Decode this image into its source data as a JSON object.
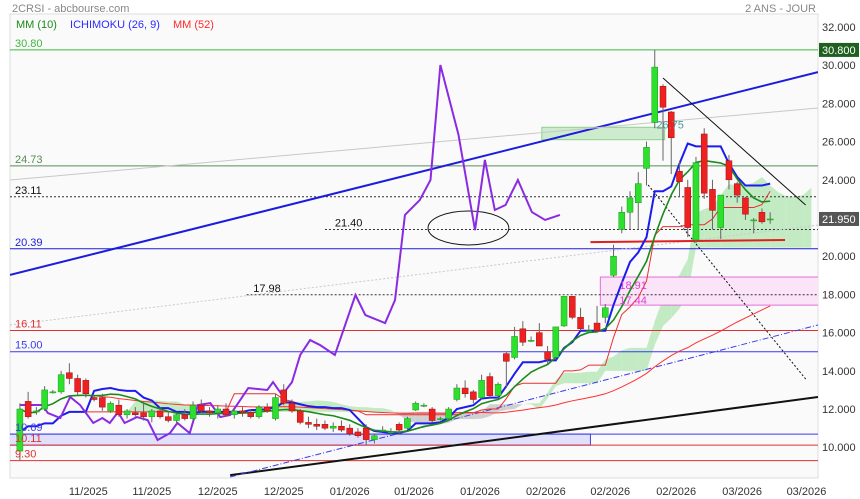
{
  "header": {
    "title": "2CRSI - abcbourse.com",
    "period": "2 ANS - JOUR"
  },
  "legend": [
    {
      "label": "MM (10)",
      "color": "#1a8a1a"
    },
    {
      "label": "ICHIMOKU (26, 9)",
      "color": "#2b2bff"
    },
    {
      "label": "MM (52)",
      "color": "#ff2a2a"
    }
  ],
  "chart_data": {
    "type": "candlestick",
    "title": "2CRSI",
    "ylim": [
      8.39,
      32.68
    ],
    "xlim": [
      -1.2,
      96.8
    ],
    "y_ticks": [
      "32.000",
      "30.000",
      "28.000",
      "26.000",
      "24.000",
      "22.000",
      "20.000",
      "18.000",
      "16.000",
      "14.000",
      "12.000",
      "10.000"
    ],
    "x_ticks": [
      {
        "i": 8.3,
        "label": "11/2025"
      },
      {
        "i": 16.0,
        "label": "11/2025"
      },
      {
        "i": 24.0,
        "label": "12/2025"
      },
      {
        "i": 32.0,
        "label": "12/2025"
      },
      {
        "i": 40.0,
        "label": "01/2026"
      },
      {
        "i": 47.8,
        "label": "01/2026"
      },
      {
        "i": 55.8,
        "label": "01/2026"
      },
      {
        "i": 63.8,
        "label": "02/2026"
      },
      {
        "i": 71.6,
        "label": "02/2026"
      },
      {
        "i": 79.6,
        "label": "02/2026"
      },
      {
        "i": 87.6,
        "label": "03/2026"
      },
      {
        "i": 95.4,
        "label": "03/2026"
      }
    ],
    "price_badges": [
      {
        "value": 30.8,
        "label": "30.800",
        "color": "#1f5f1f"
      },
      {
        "value": 21.95,
        "label": "21.950",
        "color": "#555555"
      }
    ],
    "candles_ohlc": [
      [
        9.8,
        12.3,
        9.3,
        12.0
      ],
      [
        12.4,
        12.9,
        11.5,
        11.6
      ],
      [
        11.9,
        12.1,
        11.7,
        11.9
      ],
      [
        12.0,
        13.2,
        11.9,
        13.0
      ],
      [
        12.9,
        13.0,
        12.8,
        12.9
      ],
      [
        12.9,
        14.0,
        12.8,
        13.8
      ],
      [
        13.9,
        14.4,
        13.3,
        13.6
      ],
      [
        13.6,
        13.8,
        12.7,
        12.9
      ],
      [
        13.5,
        13.6,
        12.6,
        12.8
      ],
      [
        12.6,
        12.7,
        12.4,
        12.5
      ],
      [
        12.6,
        12.8,
        11.9,
        12.1
      ],
      [
        11.9,
        12.4,
        11.8,
        12.3
      ],
      [
        12.2,
        12.5,
        11.6,
        11.7
      ],
      [
        11.7,
        12.0,
        11.5,
        11.9
      ],
      [
        11.8,
        12.1,
        11.6,
        11.7
      ],
      [
        11.8,
        12.3,
        11.4,
        11.6
      ],
      [
        11.6,
        12.0,
        11.3,
        11.9
      ],
      [
        11.9,
        12.1,
        11.5,
        11.6
      ],
      [
        11.6,
        11.9,
        11.3,
        11.4
      ],
      [
        11.4,
        11.8,
        11.2,
        11.7
      ],
      [
        11.7,
        12.0,
        11.4,
        11.5
      ],
      [
        11.5,
        12.4,
        11.4,
        12.2
      ],
      [
        12.2,
        12.5,
        11.8,
        11.9
      ],
      [
        11.9,
        12.1,
        11.6,
        11.8
      ],
      [
        11.8,
        12.2,
        11.5,
        12.0
      ],
      [
        12.0,
        12.3,
        11.6,
        11.7
      ],
      [
        11.7,
        12.0,
        11.5,
        11.9
      ],
      [
        11.9,
        12.1,
        11.6,
        11.8
      ],
      [
        11.8,
        12.0,
        11.5,
        11.6
      ],
      [
        11.6,
        12.2,
        11.5,
        12.1
      ],
      [
        12.1,
        12.3,
        11.8,
        11.9
      ],
      [
        11.5,
        12.8,
        11.4,
        12.6
      ],
      [
        13.0,
        13.3,
        12.2,
        12.3
      ],
      [
        12.3,
        12.5,
        11.8,
        11.9
      ],
      [
        11.9,
        12.0,
        11.2,
        11.3
      ],
      [
        11.3,
        11.6,
        11.0,
        11.2
      ],
      [
        11.2,
        11.5,
        10.9,
        11.1
      ],
      [
        11.2,
        11.4,
        10.9,
        11.0
      ],
      [
        11.0,
        11.3,
        10.8,
        11.1
      ],
      [
        11.1,
        11.4,
        10.8,
        10.9
      ],
      [
        11.0,
        11.2,
        10.6,
        10.7
      ],
      [
        10.8,
        11.0,
        10.5,
        10.6
      ],
      [
        11.0,
        11.2,
        10.1,
        10.4
      ],
      [
        10.4,
        10.7,
        10.2,
        10.6
      ],
      [
        10.9,
        11.1,
        10.8,
        10.9
      ],
      [
        10.8,
        11.0,
        10.7,
        10.8
      ],
      [
        11.2,
        11.3,
        10.7,
        10.9
      ],
      [
        11.0,
        11.6,
        10.9,
        11.5
      ],
      [
        11.95,
        12.4,
        11.9,
        12.3
      ],
      [
        12.2,
        12.3,
        12.1,
        12.2
      ],
      [
        12.0,
        12.1,
        11.3,
        11.4
      ],
      [
        11.5,
        11.6,
        11.4,
        11.5
      ],
      [
        11.5,
        12.1,
        11.4,
        12.0
      ],
      [
        12.5,
        13.3,
        12.4,
        13.1
      ],
      [
        13.1,
        13.5,
        12.6,
        12.8
      ],
      [
        12.9,
        13.0,
        12.3,
        12.5
      ],
      [
        12.6,
        13.8,
        12.5,
        13.5
      ],
      [
        13.7,
        13.9,
        12.6,
        12.7
      ],
      [
        12.7,
        13.4,
        12.5,
        13.3
      ],
      [
        14.9,
        15.0,
        13.1,
        14.5
      ],
      [
        14.7,
        16.3,
        14.6,
        15.8
      ],
      [
        16.2,
        16.6,
        15.3,
        15.5
      ],
      [
        15.6,
        15.8,
        15.5,
        15.6
      ],
      [
        16.0,
        16.5,
        15.3,
        15.3
      ],
      [
        15.0,
        15.3,
        14.3,
        14.6
      ],
      [
        14.7,
        16.3,
        14.6,
        16.3
      ],
      [
        16.35,
        17.9,
        16.3,
        17.9
      ],
      [
        17.9,
        17.9,
        16.7,
        16.8
      ],
      [
        16.8,
        17.3,
        16.1,
        16.2
      ],
      [
        16.1,
        16.4,
        16.0,
        16.1
      ],
      [
        16.5,
        17.4,
        16.0,
        16.1
      ],
      [
        16.8,
        17.5,
        16.5,
        17.3
      ],
      [
        19.0,
        20.6,
        18.9,
        20.0
      ],
      [
        21.4,
        22.6,
        21.2,
        22.3
      ],
      [
        22.3,
        23.4,
        21.4,
        23.05
      ],
      [
        22.8,
        24.4,
        21.4,
        23.8
      ],
      [
        24.6,
        26.0,
        23.7,
        25.7
      ],
      [
        27.0,
        30.8,
        26.7,
        29.9
      ],
      [
        28.9,
        29.0,
        25.0,
        27.8
      ],
      [
        27.55,
        27.6,
        24.3,
        26.2
      ],
      [
        24.45,
        25.0,
        23.1,
        23.9
      ],
      [
        23.6,
        24.0,
        21.0,
        21.5
      ],
      [
        20.85,
        25.2,
        20.7,
        24.9
      ],
      [
        26.4,
        26.7,
        23.0,
        23.3
      ],
      [
        23.5,
        24.0,
        21.4,
        22.4
      ],
      [
        21.5,
        23.2,
        20.9,
        23.2
      ],
      [
        25.0,
        25.3,
        23.5,
        24.0
      ],
      [
        23.8,
        23.9,
        22.8,
        23.2
      ],
      [
        23.05,
        23.1,
        21.9,
        22.2
      ],
      [
        21.9,
        22.0,
        21.2,
        21.9
      ],
      [
        22.3,
        22.5,
        21.7,
        21.8
      ],
      [
        21.95,
        22.3,
        21.7,
        21.95
      ]
    ],
    "comparison_series": {
      "color": "#8a2be2",
      "points": [
        [
          0,
          12.21
        ],
        [
          2.7,
          12.21
        ],
        [
          3.4,
          11.79
        ],
        [
          4.9,
          11.53
        ],
        [
          6.1,
          12.63
        ],
        [
          7.3,
          12.21
        ],
        [
          8.9,
          11.27
        ],
        [
          10.0,
          11.53
        ],
        [
          10.9,
          11.27
        ],
        [
          11.9,
          11.84
        ],
        [
          12.7,
          11.27
        ],
        [
          14.2,
          11.58
        ],
        [
          15.5,
          11.42
        ],
        [
          16.7,
          10.38
        ],
        [
          18.2,
          10.74
        ],
        [
          19.1,
          11.27
        ],
        [
          20.6,
          10.74
        ],
        [
          21.6,
          12.21
        ],
        [
          23.1,
          12.31
        ],
        [
          24.3,
          11.58
        ],
        [
          25.5,
          11.69
        ],
        [
          27.7,
          13.1
        ],
        [
          30.0,
          13.0
        ],
        [
          30.7,
          13.41
        ],
        [
          31.8,
          12.73
        ],
        [
          33.0,
          13.41
        ],
        [
          34.0,
          14.83
        ],
        [
          35.2,
          15.61
        ],
        [
          36.4,
          15.35
        ],
        [
          38.2,
          14.83
        ],
        [
          40.7,
          17.97
        ],
        [
          41.9,
          16.92
        ],
        [
          44.3,
          16.5
        ],
        [
          45.5,
          17.71
        ],
        [
          46.7,
          22.16
        ],
        [
          48.5,
          22.94
        ],
        [
          49.8,
          23.99
        ],
        [
          51.0,
          30.01
        ],
        [
          53.2,
          26.35
        ],
        [
          55.2,
          21.37
        ],
        [
          56.4,
          25.04
        ],
        [
          57.6,
          22.42
        ],
        [
          58.9,
          22.68
        ],
        [
          60.4,
          23.99
        ],
        [
          62.1,
          22.31
        ],
        [
          63.7,
          21.9
        ],
        [
          65.5,
          22.16
        ]
      ]
    },
    "levels": [
      {
        "value": 30.8,
        "label": "30.80",
        "color": "#3cb93c",
        "style": "solid",
        "label_at": -1
      },
      {
        "value": 24.73,
        "label": "24.73",
        "color": "#5a8a5a",
        "style": "solid",
        "label_at": -1
      },
      {
        "value": 23.11,
        "label": "23.11",
        "color": "#333333",
        "style": "dotted",
        "label_at": -1
      },
      {
        "value": 21.4,
        "label": "21.40",
        "color": "#333333",
        "style": "dotted",
        "label_at": 38.2,
        "from": 37
      },
      {
        "value": 20.39,
        "label": "20.39",
        "color": "#1c1cdd",
        "style": "solid",
        "label_at": -1
      },
      {
        "value": 17.98,
        "label": "17.98",
        "color": "#333333",
        "style": "dotted",
        "label_at": 28.3,
        "from": 27.5
      },
      {
        "value": 16.11,
        "label": "16.11",
        "color": "#e03030",
        "style": "solid",
        "label_at": -1
      },
      {
        "value": 15.0,
        "label": "15.00",
        "color": "#3a3aee",
        "style": "solid",
        "label_at": -1
      },
      {
        "value": 10.69,
        "label": "10.69",
        "color": "#3a3aee",
        "style": "solid",
        "label_at": -1
      },
      {
        "value": 10.11,
        "label": "10.11",
        "color": "#e03030",
        "style": "solid",
        "label_at": -1
      },
      {
        "value": 9.3,
        "label": "9.30",
        "color": "#e03030",
        "style": "solid",
        "label_at": -1
      }
    ],
    "zones": [
      {
        "name": "resistance-zone",
        "from_i": 63.3,
        "to_i": 78.2,
        "low": 26.1,
        "high": 26.75,
        "label": "26.75",
        "fill": "#cdeccd",
        "stroke": "#8fd18f",
        "label_color": "#4a9a9a"
      },
      {
        "name": "gap-zone",
        "from_i": 70.4,
        "to_i": 100,
        "low": 17.44,
        "high": 18.91,
        "label_hi": "18.91",
        "label_lo": "17.44",
        "fill": "#fbe4f8",
        "stroke": "#e070d8",
        "label_color": "#e040d0"
      },
      {
        "name": "support-zone",
        "from_i": -1.3,
        "to_i": 69.2,
        "low": 10.11,
        "high": 10.69,
        "fill": "#e0e0fa",
        "stroke": "#4040ee"
      }
    ],
    "trendlines": [
      {
        "name": "blue-trendline",
        "p1": [
          -1.2,
          19.02
        ],
        "p2": [
          96.8,
          29.64
        ],
        "color": "#1c1cdd",
        "width": 2,
        "dash": ""
      },
      {
        "name": "gray-trendline",
        "p1": [
          -1.2,
          23.99
        ],
        "p2": [
          96.8,
          27.76
        ],
        "color": "#c8c8c8",
        "width": 1,
        "dash": ""
      },
      {
        "name": "gray-dotted-trendline",
        "p1": [
          -1.2,
          16.4
        ],
        "p2": [
          96.8,
          21.63
        ],
        "color": "#c8c8c8",
        "width": 1,
        "dash": "2,2"
      },
      {
        "name": "black-support-trendline",
        "p1": [
          25.5,
          8.54
        ],
        "p2": [
          96.8,
          12.63
        ],
        "color": "#111111",
        "width": 2,
        "dash": ""
      },
      {
        "name": "blue-dashdot-trendline",
        "p1": [
          25.5,
          8.44
        ],
        "p2": [
          96.8,
          16.4
        ],
        "color": "#3a3aee",
        "width": 1,
        "dash": "6,2,1,2"
      },
      {
        "name": "triangle-resistance-line",
        "p1": [
          78.0,
          29.33
        ],
        "p2": [
          95.3,
          22.68
        ],
        "color": "#111111",
        "width": 1,
        "dash": ""
      },
      {
        "name": "projection-dotted-line",
        "p1": [
          76.2,
          23.73
        ],
        "p2": [
          95.4,
          13.52
        ],
        "color": "#111111",
        "width": 1,
        "dash": "2,2"
      },
      {
        "name": "red-support-segment",
        "p1": [
          69.2,
          20.74
        ],
        "p2": [
          92.8,
          20.85
        ],
        "color": "#e02020",
        "width": 2,
        "dash": ""
      }
    ],
    "ellipse": {
      "center": [
        54.4,
        21.48
      ],
      "ri": 4.9,
      "rp": 0.89
    },
    "colors": {
      "up": "#2ee02e",
      "down": "#ee2020",
      "mm10": "#1a8a1a",
      "mm52": "#ff3030",
      "tenkan": "#1c1cee",
      "kijun": "#e83030",
      "cloud_up": "#b8e8b8",
      "cloud_down": "#c8c8c8"
    }
  }
}
